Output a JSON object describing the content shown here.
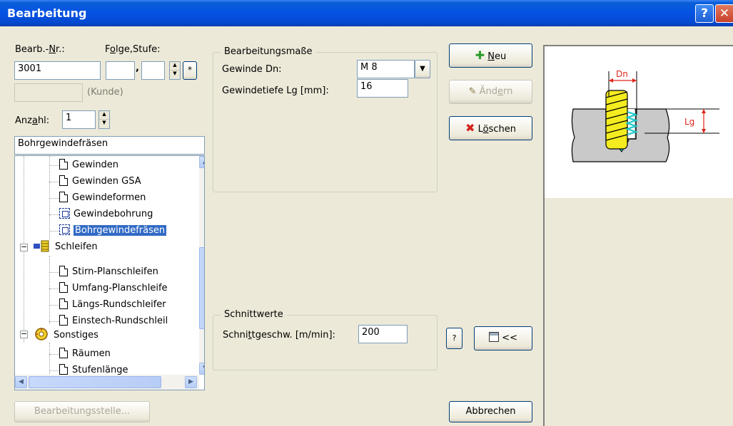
{
  "window": {
    "title": "Bearbeitung",
    "help_symbol": "?",
    "close_symbol": "✕"
  },
  "left": {
    "bearb_nr_label_pre": "Bearb.-",
    "bearb_nr_label_u": "N",
    "bearb_nr_label_post": "r.:",
    "folge_label_pre": "F",
    "folge_label_u": "o",
    "folge_label_post": "lge,Stufe:",
    "bearb_nr_value": "3001",
    "folge_sep": ",",
    "star": "*",
    "kunde_label": "(Kunde)",
    "anzahl_label_pre": "Anz",
    "anzahl_label_u": "a",
    "anzahl_label_post": "hl:",
    "anzahl_value": "1",
    "current_operation": "Bohrgewindefräsen",
    "bearbeitungsstelle_button": "Bearbeitungsstelle..."
  },
  "tree": {
    "items": [
      {
        "label": "Gewinden"
      },
      {
        "label": "Gewinden GSA"
      },
      {
        "label": "Gewindeformen"
      },
      {
        "label": "Gewindebohrung"
      },
      {
        "label": "Bohrgewindefräsen"
      },
      {
        "label": "Schleifen"
      },
      {
        "label": "Stirn-Planschleifen"
      },
      {
        "label": "Umfang-Planschleife"
      },
      {
        "label": "Längs-Rundschleifer"
      },
      {
        "label": "Einstech-Rundschleil"
      },
      {
        "label": "Sonstiges"
      },
      {
        "label": "Räumen"
      },
      {
        "label": "Stufenlänge"
      }
    ],
    "collapse_symbol": "−"
  },
  "bearbeitungsmasse": {
    "legend": "Bearbeitungsmaße",
    "gewinde_label": "Gewinde Dn:",
    "gewinde_value": "M 8",
    "gewindetiefe_label": "Gewindetiefe Lg [mm]:",
    "gewindetiefe_value": "16"
  },
  "schnittwerte": {
    "legend": "Schnittwerte",
    "schnittgeschw_label_pre": "Schni",
    "schnittgeschw_label_u": "t",
    "schnittgeschw_label_post": "tgeschw. [m/min]:",
    "schnittgeschw_value": "200",
    "help_button": "?",
    "calc_button": "<<"
  },
  "actions": {
    "neu_u": "N",
    "neu_rest": "eu",
    "aendern_pre": "Änd",
    "aendern_u": "e",
    "aendern_post": "rn",
    "loeschen_pre": "L",
    "loeschen_u": "ö",
    "loeschen_post": "schen",
    "abbrechen": "Abbrechen"
  },
  "diagram": {
    "dn_label": "Dn",
    "lg_label": "Lg"
  },
  "colors": {
    "accent_red": "#e0251b",
    "selection": "#316ac5",
    "tool_yellow": "#f4ec1f",
    "tool_cyan": "#1fcaca"
  }
}
